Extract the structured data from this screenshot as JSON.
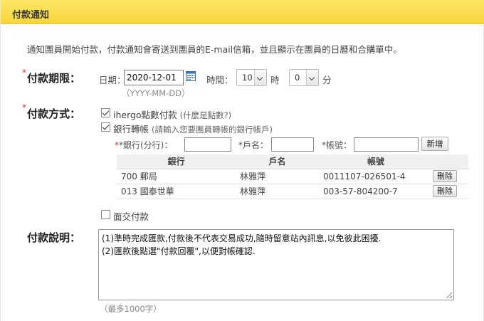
{
  "header": {
    "title": "付款通知"
  },
  "intro": "通知團員開始付款，付款通知會寄送到團員的E-mail信箱，並且顯示在團員的日曆和合購單中。",
  "required_mark": "*",
  "period": {
    "label": "付款期限：",
    "date_label": "日期：",
    "date_value": "2020-12-01",
    "date_hint": "（YYYY-MM-DD）",
    "time_label": "時間：",
    "hour_value": "10",
    "hour_unit": "時",
    "minute_value": "0",
    "minute_unit": "分"
  },
  "method": {
    "label": "付款方式：",
    "points": {
      "checked": true,
      "label": "ihergo點數付款",
      "link": "(什麼是點數?)"
    },
    "bank": {
      "checked": true,
      "label": "銀行轉帳",
      "note": "(請輸入您要團員轉帳的銀行帳戶)"
    },
    "bank_form": {
      "bank_label": "*銀行(分行)：",
      "name_label": "*戶名：",
      "account_label": "*帳號：",
      "add_button": "新增"
    },
    "table": {
      "headers": [
        "銀行",
        "戶名",
        "帳號",
        ""
      ],
      "rows": [
        {
          "bank": "700 郵局",
          "name": "林雅萍",
          "account": "0011107-026501-4",
          "action": "刪除"
        },
        {
          "bank": "013 國泰世華",
          "name": "林雅萍",
          "account": "003-57-804200-7",
          "action": "刪除"
        }
      ]
    },
    "face_to_face": {
      "checked": false,
      "label": "面交付款"
    }
  },
  "description": {
    "label": "付款說明：",
    "lines": [
      "(1)準時完成匯款,付款後不代表交易成功,隨時留意站內訊息,以免彼此困擾.",
      "(2)匯款後點選\"付款回覆\",以便對帳確認."
    ],
    "limit_hint": "（最多1000字）"
  },
  "colors": {
    "header_bg": "#f9dc4a",
    "required": "#d9302c"
  }
}
